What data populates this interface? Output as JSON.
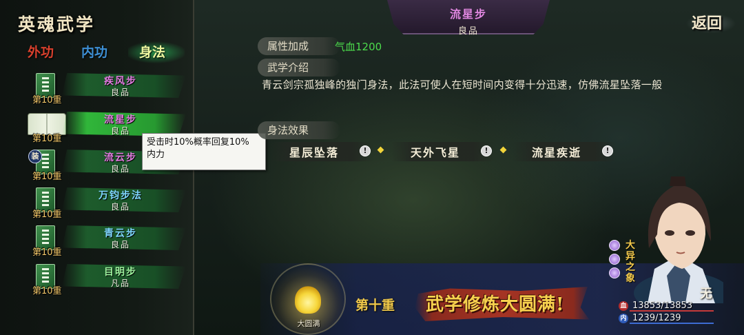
{
  "panel": {
    "title": "英魂武学"
  },
  "tabs": [
    {
      "label": "外功",
      "color": "#d8402d"
    },
    {
      "label": "内功",
      "color": "#3d8fd4"
    },
    {
      "label": "身法",
      "color": "#eef7a0",
      "selected": true
    }
  ],
  "skills": [
    {
      "name": "疾风步",
      "grade": "良品",
      "level": "第10重",
      "name_color": "#e27be0"
    },
    {
      "name": "流星步",
      "grade": "良品",
      "level": "第10重",
      "name_color": "#e27be0",
      "selected": true
    },
    {
      "name": "流云步",
      "grade": "良品",
      "level": "第10重",
      "name_color": "#e27be0",
      "badge": "装"
    },
    {
      "name": "万钧步法",
      "grade": "良品",
      "level": "第10重",
      "name_color": "#7fd7ff"
    },
    {
      "name": "青云步",
      "grade": "良品",
      "level": "第10重",
      "name_color": "#7fd7ff"
    },
    {
      "name": "目明步",
      "grade": "凡品",
      "level": "第10重",
      "name_color": "#9ef29e"
    }
  ],
  "tooltip": {
    "line1": "受击时10%概率回复10%",
    "line2": "内力"
  },
  "detail": {
    "title": "流星步",
    "grade": "良品",
    "attr_label": "属性加成",
    "attr_value": "气血1200",
    "intro_label": "武学介绍",
    "intro_text": "青云剑宗孤独峰的独门身法，此法可使人在短时间内变得十分迅速，仿佛流星坠落一般",
    "effects_label": "身法效果",
    "effects": [
      {
        "name": "星辰坠落",
        "info": "!"
      },
      {
        "name": "天外飞星",
        "info": "!"
      },
      {
        "name": "流星疾逝",
        "info": "!"
      }
    ]
  },
  "return_label": "返回",
  "bottom": {
    "orb_label": "大圆满",
    "tier": "第十重",
    "complete": "武学修炼大圆满!"
  },
  "character": {
    "title": "大异之象",
    "name": "无",
    "hp_icon": "血",
    "hp": "13853/13853",
    "mp_icon": "内",
    "mp": "1239/1239"
  }
}
